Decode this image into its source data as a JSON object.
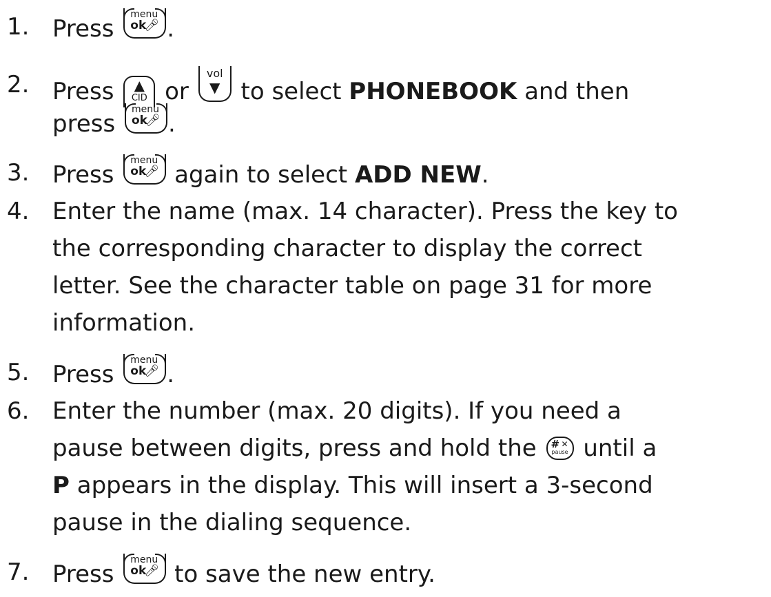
{
  "keys": {
    "menu_ok": {
      "top": "menu",
      "bottom": "ok",
      "icon": "mute-mic-icon"
    },
    "cid": {
      "icon": "up-arrow-icon",
      "label": "CID"
    },
    "vol": {
      "label": "vol",
      "icon": "down-arrow-icon"
    },
    "hash": {
      "symbol": "#",
      "icon": "ringer-off-icon",
      "label": "pause"
    }
  },
  "steps": [
    {
      "number": "1.",
      "text": [
        "Press",
        "."
      ]
    },
    {
      "number": "2.",
      "text": [
        "Press",
        "or",
        "to select",
        "PHONEBOOK",
        "and then",
        "press",
        "."
      ]
    },
    {
      "number": "3.",
      "text": [
        "Press",
        "again to select",
        "ADD NEW",
        "."
      ]
    },
    {
      "number": "4.",
      "lines": [
        "Enter the name (max. 14 character). Press the key to",
        "the corresponding character to display the correct",
        "letter. See the character table on page 31 for more",
        "information."
      ]
    },
    {
      "number": "5.",
      "text": [
        "Press",
        "."
      ]
    },
    {
      "number": "6.",
      "lines": [
        "Enter the number (max. 20 digits). If you need a",
        "pause between digits, press and hold the",
        "until a",
        "P",
        "appears in the display. This will insert a 3-second",
        "pause in the dialing sequence."
      ]
    },
    {
      "number": "7.",
      "text": [
        "Press",
        "to save the new entry."
      ]
    }
  ]
}
